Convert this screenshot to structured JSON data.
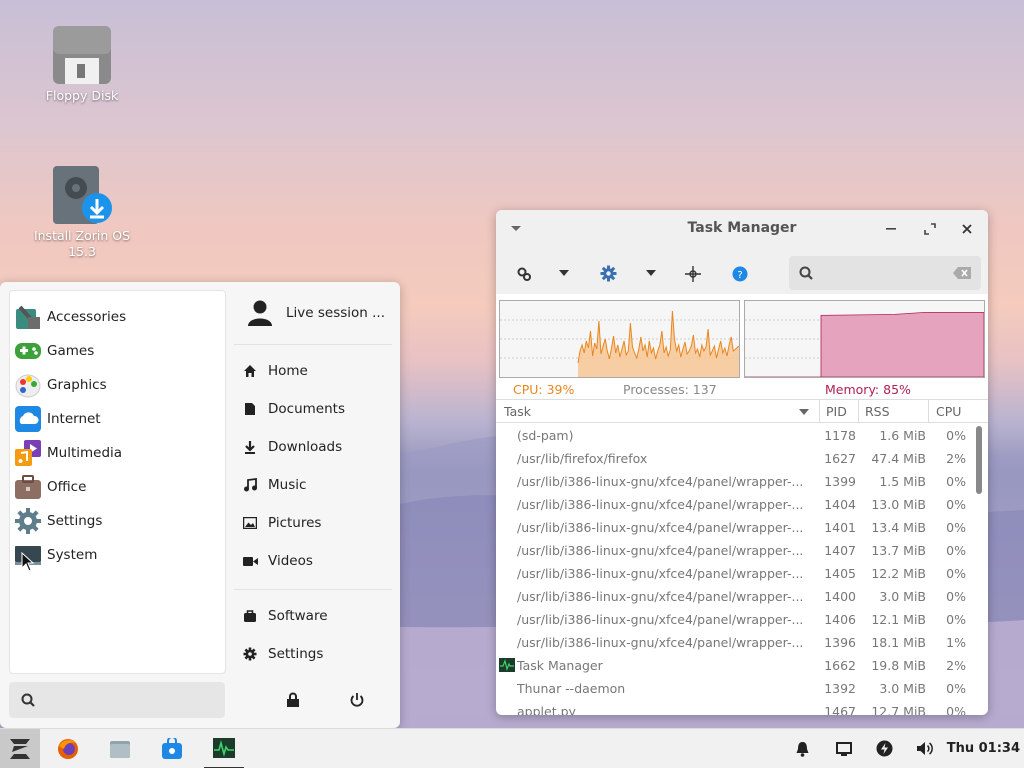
{
  "desktop": {
    "icons": [
      {
        "label": "Floppy Disk"
      },
      {
        "label": "Install Zorin OS 15.3"
      }
    ]
  },
  "start_menu": {
    "categories": [
      {
        "label": "Accessories",
        "icon": "accessories-icon"
      },
      {
        "label": "Games",
        "icon": "games-icon"
      },
      {
        "label": "Graphics",
        "icon": "graphics-icon"
      },
      {
        "label": "Internet",
        "icon": "internet-icon"
      },
      {
        "label": "Multimedia",
        "icon": "multimedia-icon"
      },
      {
        "label": "Office",
        "icon": "office-icon"
      },
      {
        "label": "Settings",
        "icon": "settings-icon"
      },
      {
        "label": "System",
        "icon": "system-icon"
      }
    ],
    "user": "Live session ...",
    "places": [
      {
        "label": "Home",
        "icon": "home-icon"
      },
      {
        "label": "Documents",
        "icon": "document-icon"
      },
      {
        "label": "Downloads",
        "icon": "download-icon"
      },
      {
        "label": "Music",
        "icon": "music-icon"
      },
      {
        "label": "Pictures",
        "icon": "pictures-icon"
      },
      {
        "label": "Videos",
        "icon": "video-icon"
      }
    ],
    "apps": [
      {
        "label": "Software",
        "icon": "software-icon"
      },
      {
        "label": "Settings",
        "icon": "gear-icon"
      }
    ],
    "search_placeholder": ""
  },
  "task_manager": {
    "title": "Task Manager",
    "cpu_label": "CPU: 39%",
    "processes_label": "Processes: 137",
    "memory_label": "Memory: 85%",
    "cpu_color": "#e8871e",
    "memory_color": "#b02050",
    "memory_fill": 0.85,
    "columns": {
      "task": "Task",
      "pid": "PID",
      "rss": "RSS",
      "cpu": "CPU"
    },
    "rows": [
      {
        "task": "(sd-pam)",
        "pid": "1178",
        "rss": "1.6 MiB",
        "cpu": "0%"
      },
      {
        "task": "/usr/lib/firefox/firefox",
        "pid": "1627",
        "rss": "47.4 MiB",
        "cpu": "2%"
      },
      {
        "task": "/usr/lib/i386-linux-gnu/xfce4/panel/wrapper-...",
        "pid": "1399",
        "rss": "1.5 MiB",
        "cpu": "0%"
      },
      {
        "task": "/usr/lib/i386-linux-gnu/xfce4/panel/wrapper-...",
        "pid": "1404",
        "rss": "13.0 MiB",
        "cpu": "0%"
      },
      {
        "task": "/usr/lib/i386-linux-gnu/xfce4/panel/wrapper-...",
        "pid": "1401",
        "rss": "13.4 MiB",
        "cpu": "0%"
      },
      {
        "task": "/usr/lib/i386-linux-gnu/xfce4/panel/wrapper-...",
        "pid": "1407",
        "rss": "13.7 MiB",
        "cpu": "0%"
      },
      {
        "task": "/usr/lib/i386-linux-gnu/xfce4/panel/wrapper-...",
        "pid": "1405",
        "rss": "12.2 MiB",
        "cpu": "0%"
      },
      {
        "task": "/usr/lib/i386-linux-gnu/xfce4/panel/wrapper-...",
        "pid": "1400",
        "rss": "3.0 MiB",
        "cpu": "0%"
      },
      {
        "task": "/usr/lib/i386-linux-gnu/xfce4/panel/wrapper-...",
        "pid": "1406",
        "rss": "12.1 MiB",
        "cpu": "0%"
      },
      {
        "task": "/usr/lib/i386-linux-gnu/xfce4/panel/wrapper-...",
        "pid": "1396",
        "rss": "18.1 MiB",
        "cpu": "1%"
      },
      {
        "task": "Task Manager",
        "pid": "1662",
        "rss": "19.8 MiB",
        "cpu": "2%"
      },
      {
        "task": "Thunar --daemon",
        "pid": "1392",
        "rss": "3.0 MiB",
        "cpu": "0%"
      },
      {
        "task": "applet.py",
        "pid": "1467",
        "rss": "12.7 MiB",
        "cpu": "0%"
      }
    ]
  },
  "taskbar": {
    "clock": "Thu 01:34"
  }
}
